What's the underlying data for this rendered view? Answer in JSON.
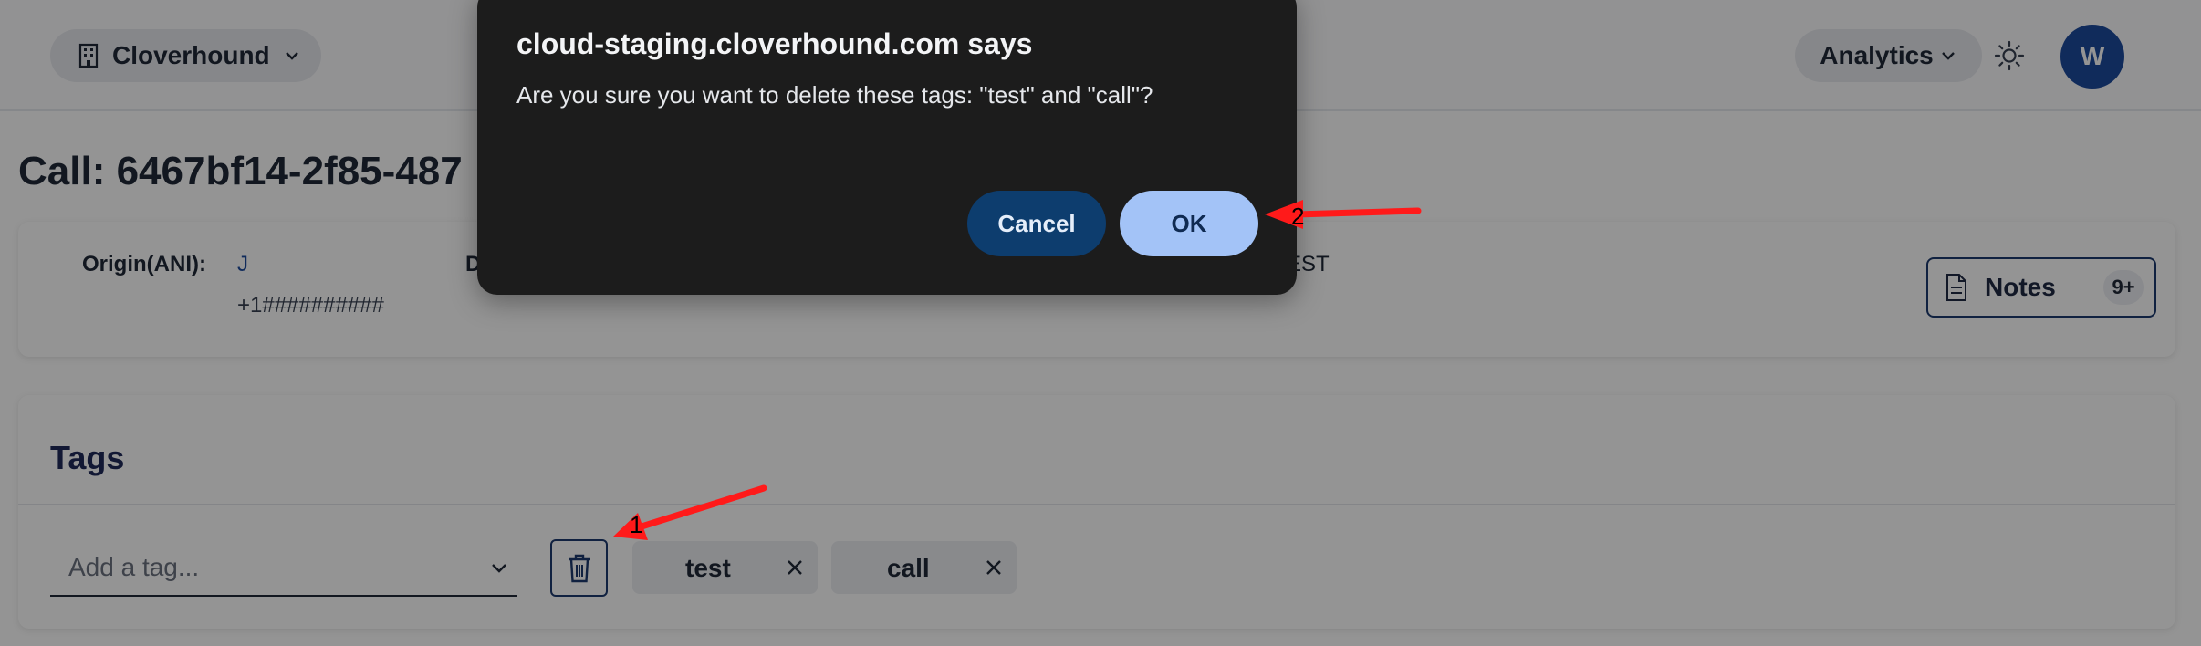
{
  "header": {
    "org_name": "Cloverhound",
    "analytics_label": "Analytics",
    "avatar_initial": "W"
  },
  "page": {
    "title": "Call: 6467bf14-2f85-487"
  },
  "call_info": {
    "origin_label": "Origin(ANI):",
    "origin_name": "J",
    "origin_phone": "+1##########",
    "dest_label_partial": "D",
    "est_partial": "EST"
  },
  "notes": {
    "label": "Notes",
    "count_badge": "9+"
  },
  "tags": {
    "title": "Tags",
    "input_placeholder": "Add a tag...",
    "items": [
      {
        "label": "test"
      },
      {
        "label": "call"
      }
    ]
  },
  "dialog": {
    "title": "cloud-staging.cloverhound.com says",
    "message": "Are you sure you want to delete these tags: \"test\" and \"call\"?",
    "cancel_label": "Cancel",
    "ok_label": "OK"
  },
  "annotations": {
    "arrow_1_label": "1",
    "arrow_2_label": "2",
    "arrow_color": "#ff1a1a"
  }
}
